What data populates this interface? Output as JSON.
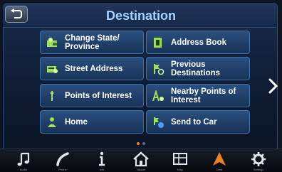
{
  "header": {
    "title": "Destination"
  },
  "menu": [
    {
      "label": "Change State/\nProvince",
      "icon": "map-pin-state-icon"
    },
    {
      "label": "Address Book",
      "icon": "address-book-icon"
    },
    {
      "label": "Street Address",
      "icon": "street-address-icon"
    },
    {
      "label": "Previous\nDestinations",
      "icon": "previous-destinations-icon"
    },
    {
      "label": "Points of Interest",
      "icon": "poi-flag-icon"
    },
    {
      "label": "Nearby Points of\nInterest",
      "icon": "nearby-poi-icon"
    },
    {
      "label": "Home",
      "icon": "home-person-icon"
    },
    {
      "label": "Send to Car",
      "icon": "send-to-car-icon"
    }
  ],
  "bottom_bar": [
    {
      "label": "Audio",
      "icon": "music-note-icon"
    },
    {
      "label": "Phone",
      "icon": "phone-icon"
    },
    {
      "label": "Info",
      "icon": "info-icon"
    },
    {
      "label": "Nissan",
      "icon": "home-icon"
    },
    {
      "label": "Map",
      "icon": "map-icon"
    },
    {
      "label": "Dest",
      "icon": "navigation-arrow-icon",
      "active": true
    },
    {
      "label": "Settings",
      "icon": "gear-icon"
    }
  ],
  "colors": {
    "accent": "#f08020",
    "title": "#9fd4ff",
    "button": "#2a4f7e",
    "icon_green": "#9fe05a"
  }
}
